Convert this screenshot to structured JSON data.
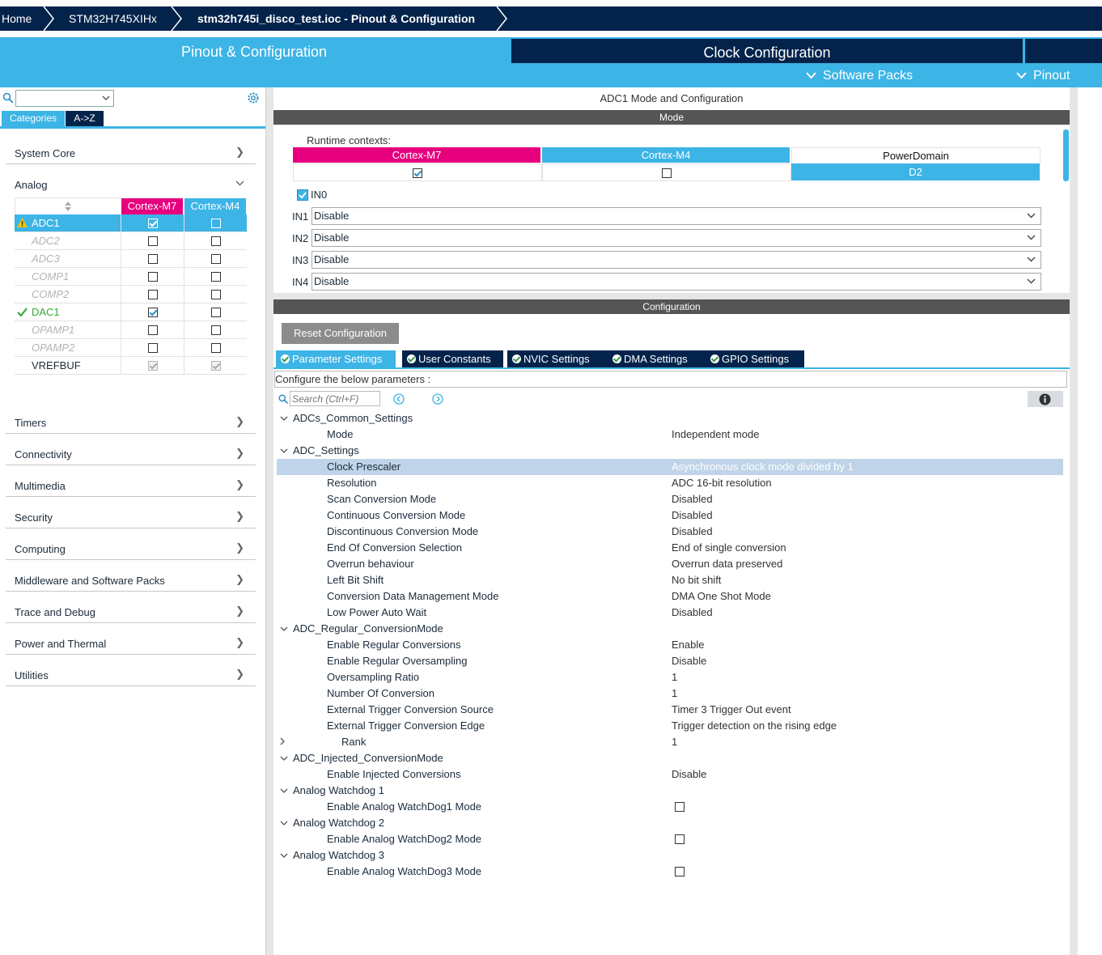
{
  "breadcrumb": {
    "home": "Home",
    "mcu": "STM32H745XIHx",
    "project": "stm32h745i_disco_test.ioc - Pinout & Configuration"
  },
  "tabs": {
    "pinout": "Pinout & Configuration",
    "clock": "Clock Configuration",
    "software_packs": "Software Packs",
    "pinout_menu": "Pinout"
  },
  "left": {
    "search_value": "",
    "view_tabs": [
      "Categories",
      "A->Z"
    ],
    "categories": [
      {
        "label": "System Core"
      },
      {
        "label": "Analog"
      },
      {
        "label": "Timers"
      },
      {
        "label": "Connectivity"
      },
      {
        "label": "Multimedia"
      },
      {
        "label": "Security"
      },
      {
        "label": "Computing"
      },
      {
        "label": "Middleware and Software Packs"
      },
      {
        "label": "Trace and Debug"
      },
      {
        "label": "Power and Thermal"
      },
      {
        "label": "Utilities"
      }
    ],
    "peripheral_table": {
      "headers": [
        "Cortex-M7",
        "Cortex-M4"
      ],
      "rows": [
        {
          "name": "ADC1",
          "status": "warning",
          "m7": true,
          "m4": false
        },
        {
          "name": "ADC2",
          "status": "disabled",
          "m7": false,
          "m4": false
        },
        {
          "name": "ADC3",
          "status": "disabled",
          "m7": false,
          "m4": false
        },
        {
          "name": "COMP1",
          "status": "disabled",
          "m7": false,
          "m4": false
        },
        {
          "name": "COMP2",
          "status": "disabled",
          "m7": false,
          "m4": false
        },
        {
          "name": "DAC1",
          "status": "ok",
          "m7": true,
          "m4": false
        },
        {
          "name": "OPAMP1",
          "status": "disabled",
          "m7": false,
          "m4": false
        },
        {
          "name": "OPAMP2",
          "status": "disabled",
          "m7": false,
          "m4": false
        },
        {
          "name": "VREFBUF",
          "status": "normal",
          "m7": true,
          "m4": true
        }
      ]
    }
  },
  "right": {
    "title": "ADC1 Mode and Configuration",
    "mode_header": "Mode",
    "runtime_label": "Runtime contexts:",
    "contexts": {
      "m7": "Cortex-M7",
      "m4": "Cortex-M4",
      "power": "PowerDomain",
      "power_value": "D2",
      "m7_checked": true,
      "m4_checked": false
    },
    "in0": {
      "label": "IN0",
      "checked": true
    },
    "inputs": [
      {
        "label": "IN1",
        "value": "Disable"
      },
      {
        "label": "IN2",
        "value": "Disable"
      },
      {
        "label": "IN3",
        "value": "Disable"
      },
      {
        "label": "IN4",
        "value": "Disable"
      }
    ],
    "config_header": "Configuration",
    "reset_button": "Reset Configuration",
    "config_tabs": [
      "Parameter Settings",
      "User Constants",
      "NVIC Settings",
      "DMA Settings",
      "GPIO Settings"
    ],
    "configure_label": "Configure the below parameters :",
    "search_placeholder": "Search (Ctrl+F)",
    "params": [
      {
        "type": "group",
        "name": "ADCs_Common_Settings",
        "twisty": "open"
      },
      {
        "type": "item",
        "name": "Mode",
        "value": "Independent mode"
      },
      {
        "type": "group",
        "name": "ADC_Settings",
        "twisty": "open"
      },
      {
        "type": "item",
        "name": "Clock Prescaler",
        "value": "Asynchronous clock mode divided by 1",
        "highlight": true
      },
      {
        "type": "item",
        "name": "Resolution",
        "value": "ADC 16-bit resolution"
      },
      {
        "type": "item",
        "name": "Scan Conversion Mode",
        "value": "Disabled"
      },
      {
        "type": "item",
        "name": "Continuous Conversion Mode",
        "value": "Disabled"
      },
      {
        "type": "item",
        "name": "Discontinuous Conversion Mode",
        "value": "Disabled"
      },
      {
        "type": "item",
        "name": "End Of Conversion Selection",
        "value": "End of single conversion"
      },
      {
        "type": "item",
        "name": "Overrun behaviour",
        "value": "Overrun data preserved"
      },
      {
        "type": "item",
        "name": "Left Bit Shift",
        "value": "No bit shift"
      },
      {
        "type": "item",
        "name": "Conversion Data Management Mode",
        "value": "DMA One Shot Mode"
      },
      {
        "type": "item",
        "name": "Low Power Auto Wait",
        "value": "Disabled"
      },
      {
        "type": "group",
        "name": "ADC_Regular_ConversionMode",
        "twisty": "open"
      },
      {
        "type": "item",
        "name": "Enable Regular Conversions",
        "value": "Enable"
      },
      {
        "type": "item",
        "name": "Enable Regular Oversampling",
        "value": "Disable"
      },
      {
        "type": "item",
        "name": "Oversampling Ratio",
        "value": "1"
      },
      {
        "type": "item",
        "name": "Number Of Conversion",
        "value": "1"
      },
      {
        "type": "item",
        "name": "External Trigger Conversion Source",
        "value": "Timer 3 Trigger Out event"
      },
      {
        "type": "item",
        "name": "External Trigger Conversion Edge",
        "value": "Trigger detection on the rising edge"
      },
      {
        "type": "subgroup",
        "name": "Rank",
        "value": "1",
        "twisty": "closed"
      },
      {
        "type": "group",
        "name": "ADC_Injected_ConversionMode",
        "twisty": "open"
      },
      {
        "type": "item",
        "name": "Enable Injected Conversions",
        "value": "Disable"
      },
      {
        "type": "group",
        "name": "Analog Watchdog 1",
        "twisty": "open"
      },
      {
        "type": "checkitem",
        "name": "Enable Analog WatchDog1 Mode",
        "checked": false
      },
      {
        "type": "group",
        "name": "Analog Watchdog 2",
        "twisty": "open"
      },
      {
        "type": "checkitem",
        "name": "Enable Analog WatchDog2 Mode",
        "checked": false
      },
      {
        "type": "group",
        "name": "Analog Watchdog 3",
        "twisty": "open"
      },
      {
        "type": "checkitem",
        "name": "Enable Analog WatchDog3 Mode",
        "checked": false
      }
    ]
  },
  "colors": {
    "navy": "#03234b",
    "accent": "#3cb4e6",
    "magenta": "#e6007e",
    "header_grey": "#555555",
    "highlight_row": "#bfd4e8"
  },
  "icons": [
    "search-icon",
    "gear-icon",
    "chevron-right-icon",
    "chevron-down-icon",
    "warning-icon",
    "check-icon",
    "info-icon",
    "prev-icon",
    "next-icon"
  ]
}
